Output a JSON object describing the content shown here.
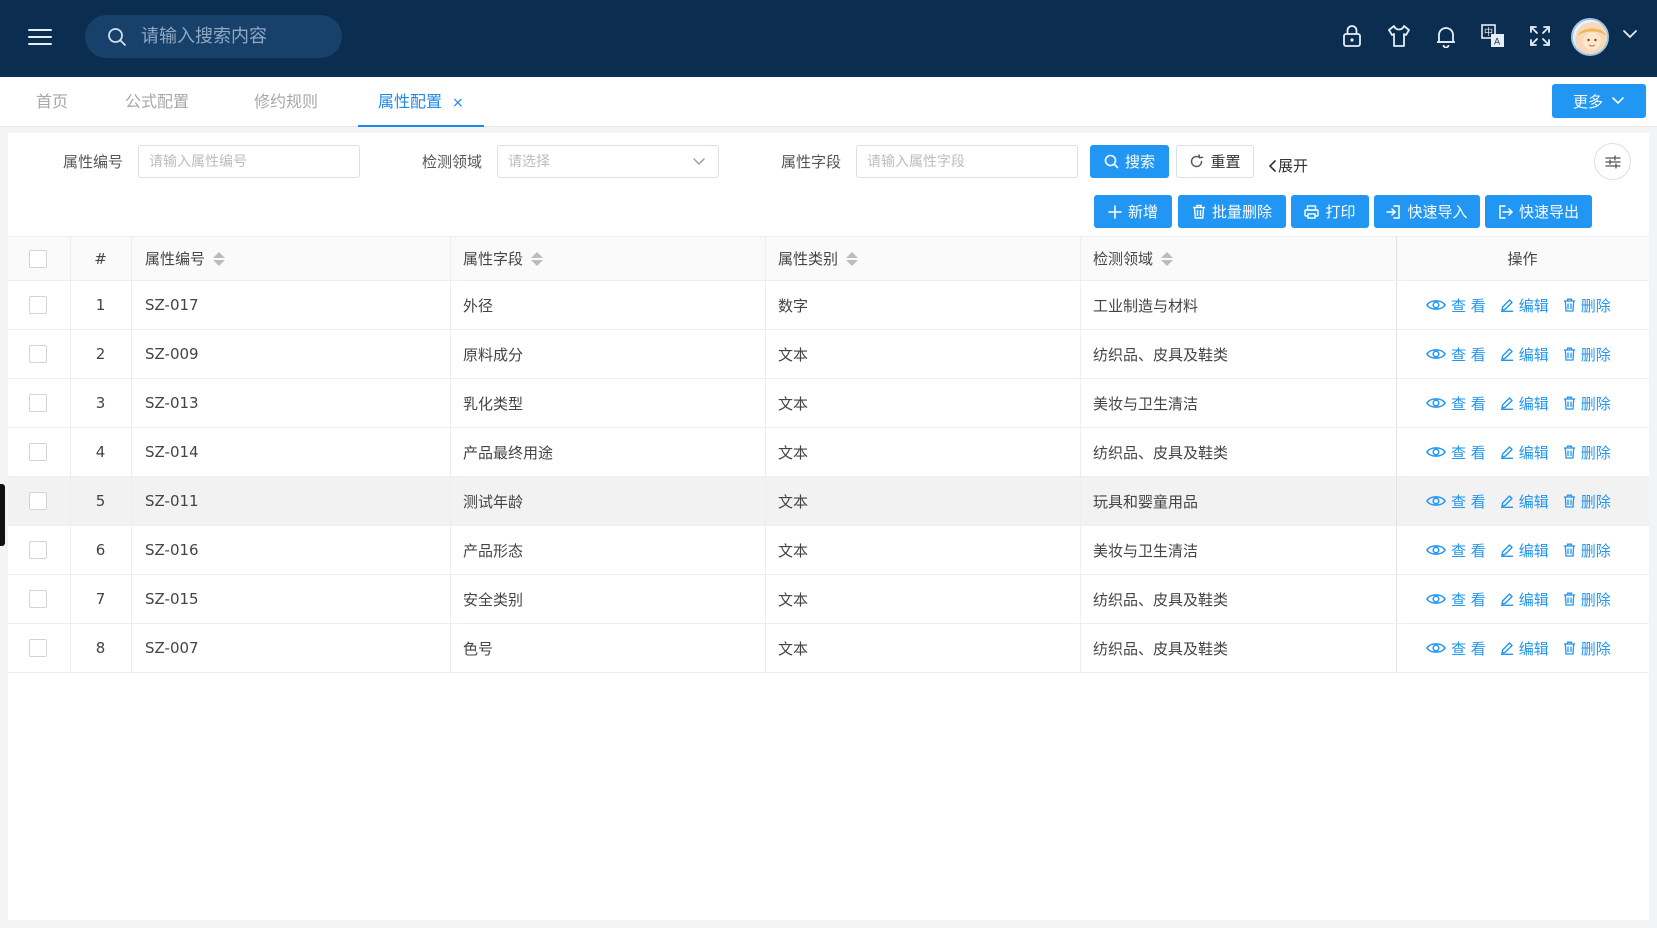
{
  "header": {
    "search_placeholder": "请输入搜索内容",
    "icons": [
      "lock-icon",
      "shirt-icon",
      "bell-icon",
      "translate-icon",
      "fullscreen-icon"
    ]
  },
  "tabs": [
    {
      "label": "首页"
    },
    {
      "label": "公式配置"
    },
    {
      "label": "修约规则"
    },
    {
      "label": "属性配置",
      "active": true,
      "close": "×"
    }
  ],
  "more_label": "更多",
  "filters": {
    "code_label": "属性编号",
    "code_placeholder": "请输入属性编号",
    "domain_label": "检测领域",
    "domain_placeholder": "请选择",
    "field_label": "属性字段",
    "field_placeholder": "请输入属性字段",
    "search_label": "搜索",
    "reset_label": "重置",
    "expand_label": "展开"
  },
  "toolbar": {
    "add_label": "新增",
    "batch_delete_label": "批量删除",
    "print_label": "打印",
    "import_label": "快速导入",
    "export_label": "快速导出"
  },
  "table": {
    "columns": {
      "index": "#",
      "code": "属性编号",
      "field": "属性字段",
      "category": "属性类别",
      "domain": "检测领域",
      "ops": "操作"
    },
    "ops": {
      "view": "查 看",
      "edit": "编辑",
      "delete": "删除"
    },
    "rows": [
      {
        "index": "1",
        "code": "SZ-017",
        "field": "外径",
        "category": "数字",
        "domain": "工业制造与材料"
      },
      {
        "index": "2",
        "code": "SZ-009",
        "field": "原料成分",
        "category": "文本",
        "domain": "纺织品、皮具及鞋类"
      },
      {
        "index": "3",
        "code": "SZ-013",
        "field": "乳化类型",
        "category": "文本",
        "domain": "美妆与卫生清洁"
      },
      {
        "index": "4",
        "code": "SZ-014",
        "field": "产品最终用途",
        "category": "文本",
        "domain": "纺织品、皮具及鞋类"
      },
      {
        "index": "5",
        "code": "SZ-011",
        "field": "测试年龄",
        "category": "文本",
        "domain": "玩具和婴童用品"
      },
      {
        "index": "6",
        "code": "SZ-016",
        "field": "产品形态",
        "category": "文本",
        "domain": "美妆与卫生清洁"
      },
      {
        "index": "7",
        "code": "SZ-015",
        "field": "安全类别",
        "category": "文本",
        "domain": "纺织品、皮具及鞋类"
      },
      {
        "index": "8",
        "code": "SZ-007",
        "field": "色号",
        "category": "文本",
        "domain": "纺织品、皮具及鞋类"
      }
    ]
  },
  "colors": {
    "header_bg": "#0b2d4f",
    "primary": "#2196f3",
    "highlight_row": "#f2f2f2"
  }
}
